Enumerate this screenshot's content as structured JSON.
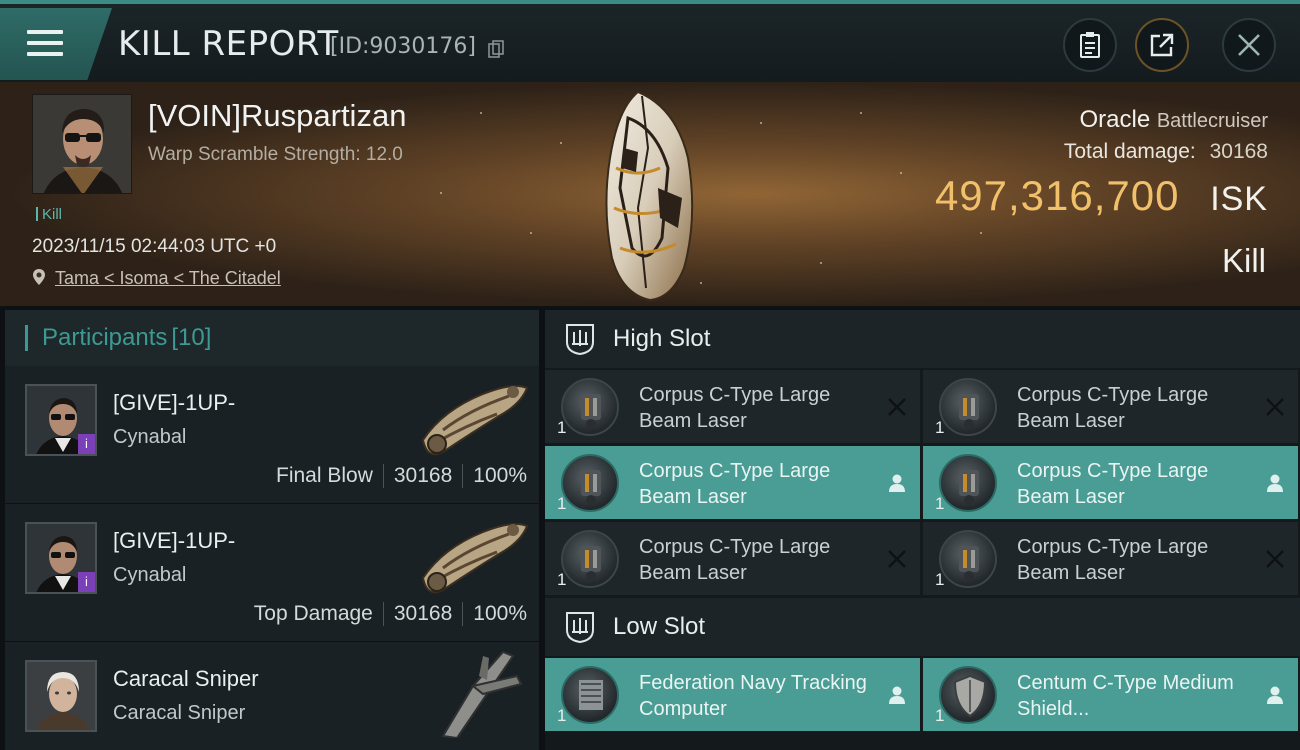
{
  "topbar": {
    "title": "KILL REPORT",
    "report_id": "[ID:9030176]"
  },
  "victim": {
    "name": "[VOIN]Ruspartizan",
    "warp_scramble": "Warp Scramble Strength: 12.0",
    "tag": "Kill",
    "timestamp": "2023/11/15 02:44:03 UTC +0",
    "location": "Tama < Isoma < The Citadel",
    "ship_name": "Oracle",
    "ship_class": "Battlecruiser",
    "total_damage_label": "Total damage:",
    "total_damage": "30168",
    "isk_value": "497,316,700",
    "isk_unit": "ISK",
    "result": "Kill"
  },
  "participants": {
    "label": "Participants",
    "count": "[10]",
    "items": [
      {
        "name": "[GIVE]-1UP-",
        "ship": "Cynabal",
        "role": "Final Blow",
        "damage": "30168",
        "percent": "100%",
        "badge": "i"
      },
      {
        "name": "[GIVE]-1UP-",
        "ship": "Cynabal",
        "role": "Top Damage",
        "damage": "30168",
        "percent": "100%",
        "badge": "i"
      },
      {
        "name": "Caracal Sniper",
        "ship": "Caracal Sniper"
      }
    ]
  },
  "fitting": {
    "high_slot": {
      "label": "High Slot",
      "modules": [
        {
          "qty": "1",
          "name": "Corpus C-Type Large Beam Laser",
          "state": "destroyed"
        },
        {
          "qty": "1",
          "name": "Corpus C-Type Large Beam Laser",
          "state": "destroyed"
        },
        {
          "qty": "1",
          "name": "Corpus C-Type Large Beam Laser",
          "state": "dropped"
        },
        {
          "qty": "1",
          "name": "Corpus C-Type Large Beam Laser",
          "state": "dropped"
        },
        {
          "qty": "1",
          "name": "Corpus C-Type Large Beam Laser",
          "state": "destroyed"
        },
        {
          "qty": "1",
          "name": "Corpus C-Type Large Beam Laser",
          "state": "destroyed"
        }
      ]
    },
    "low_slot": {
      "label": "Low Slot",
      "modules": [
        {
          "qty": "1",
          "name": "Federation Navy Tracking Computer",
          "state": "dropped"
        },
        {
          "qty": "1",
          "name": "Centum C-Type Medium Shield...",
          "state": "dropped"
        }
      ]
    }
  },
  "colors": {
    "accent": "#3d9a92",
    "isk": "#f0c06a",
    "active_module": "#4a9d94"
  },
  "icons": [
    "menu-icon",
    "copy-icon",
    "clipboard-icon",
    "share-icon",
    "close-icon",
    "location-pin-icon",
    "slot-icon",
    "destroyed-x-icon",
    "dropped-person-icon"
  ]
}
